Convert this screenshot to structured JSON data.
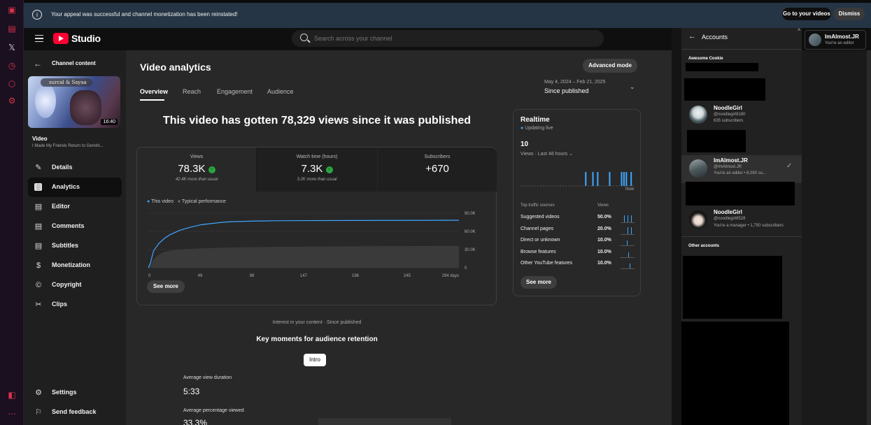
{
  "banner": {
    "message": "Your appeal was successful and channel monetization has been reinstated!",
    "go_to_videos": "Go to your videos",
    "dismiss": "Dismiss"
  },
  "header": {
    "studio_label": "Studio",
    "search_placeholder": "Search across your channel"
  },
  "user_chip": {
    "name": "ImAlmost.JR",
    "role": "You're an editor"
  },
  "nav": {
    "back_label": "Channel content",
    "thumbnail_caption": "surcal & Sayaa",
    "thumbnail_duration": "16:40",
    "video_heading": "Video",
    "video_title": "I Made My Friends Return to Genshi...",
    "items": [
      {
        "label": "Details",
        "icon": "pencil-icon"
      },
      {
        "label": "Analytics",
        "icon": "analytics-icon"
      },
      {
        "label": "Editor",
        "icon": "editor-icon"
      },
      {
        "label": "Comments",
        "icon": "comments-icon"
      },
      {
        "label": "Subtitles",
        "icon": "subtitles-icon"
      },
      {
        "label": "Monetization",
        "icon": "dollar-icon"
      },
      {
        "label": "Copyright",
        "icon": "copyright-icon"
      },
      {
        "label": "Clips",
        "icon": "scissors-icon"
      }
    ],
    "settings": "Settings",
    "send_feedback": "Send feedback"
  },
  "page": {
    "title": "Video analytics",
    "advanced_mode": "Advanced mode",
    "tabs": [
      "Overview",
      "Reach",
      "Engagement",
      "Audience"
    ],
    "date_range": "May 4, 2024 – Feb 21, 2025",
    "date_preset": "Since published",
    "headline": "This video has gotten 78,329 views since it was published"
  },
  "metrics": [
    {
      "label": "Views",
      "value": "78.3K",
      "sub": "42.4K more than usual"
    },
    {
      "label": "Watch time (hours)",
      "value": "7.3K",
      "sub": "3.2K more than usual"
    },
    {
      "label": "Subscribers",
      "value": "+670",
      "sub": ""
    }
  ],
  "legend": {
    "this_video": "This video",
    "typical": "Typical performance"
  },
  "see_more": "See more",
  "chart_data": {
    "type": "line",
    "x_ticks": [
      "0",
      "49",
      "98",
      "147",
      "196",
      "245",
      "294 days"
    ],
    "y_ticks": [
      "90.0K",
      "60.0K",
      "30.0K",
      "0"
    ],
    "ylim": [
      0,
      90000
    ],
    "series": [
      {
        "name": "This video",
        "color": "#3ea6ff",
        "x": [
          0,
          2,
          5,
          10,
          15,
          20,
          30,
          40,
          50,
          60,
          70,
          80,
          100,
          120,
          150,
          200,
          250,
          294
        ],
        "values": [
          0,
          8000,
          28000,
          40000,
          48000,
          54000,
          62000,
          67000,
          71000,
          73000,
          75000,
          76000,
          77000,
          77500,
          77800,
          78000,
          78200,
          78329
        ]
      },
      {
        "name": "Typical performance",
        "color": "#606060",
        "x": [
          0,
          5,
          10,
          15,
          20,
          30,
          50,
          80,
          120,
          200,
          294
        ],
        "values": [
          0,
          14000,
          22000,
          26000,
          28000,
          30000,
          32000,
          33500,
          34500,
          35500,
          36000
        ]
      }
    ]
  },
  "realtime": {
    "title": "Realtime",
    "status": "Updating live",
    "count": "10",
    "period": "Views · Last 48 hours",
    "now_label": "Now",
    "col_sources": "Top traffic sources",
    "col_views": "Views",
    "bars": [
      0,
      0,
      0,
      0,
      0,
      0,
      0,
      0,
      0,
      0,
      0,
      0,
      0,
      0,
      0,
      0,
      0,
      0,
      0,
      0,
      0,
      0,
      0,
      0,
      0,
      0,
      0,
      1,
      0,
      0,
      1,
      0,
      1,
      0,
      0,
      0,
      0,
      1,
      0,
      0,
      0,
      0,
      1,
      1,
      1,
      0,
      1,
      0
    ],
    "sources": [
      {
        "name": "Suggested videos",
        "pct": "50.0%"
      },
      {
        "name": "Channel pages",
        "pct": "20.0%"
      },
      {
        "name": "Direct or unknown",
        "pct": "10.0%"
      },
      {
        "name": "Browse features",
        "pct": "10.0%"
      },
      {
        "name": "Other YouTube features",
        "pct": "10.0%"
      }
    ]
  },
  "retention": {
    "subtitle": "Interest in your content · Since published",
    "title": "Key moments for audience retention",
    "chip": "Intro",
    "avg_duration_label": "Average view duration",
    "avg_duration_value": "5:33",
    "avg_pct_label": "Average percentage viewed",
    "avg_pct_value": "33.3%"
  },
  "accounts": {
    "title": "Accounts",
    "section_label": "Awesome Cookie",
    "items": [
      {
        "name": "NoodleGirl",
        "handle": "@noodlegirl8180",
        "detail": "635 subscribers"
      },
      {
        "name": "ImAlmost.JR",
        "handle": "@ImAlmost.JR",
        "detail": "You're an editor • 8,090 su..."
      },
      {
        "name": "NoodleGirl",
        "handle": "@noodlegirl8528",
        "detail": "You're a manager • 1,750 subscribers"
      }
    ],
    "other_label": "Other accounts"
  }
}
